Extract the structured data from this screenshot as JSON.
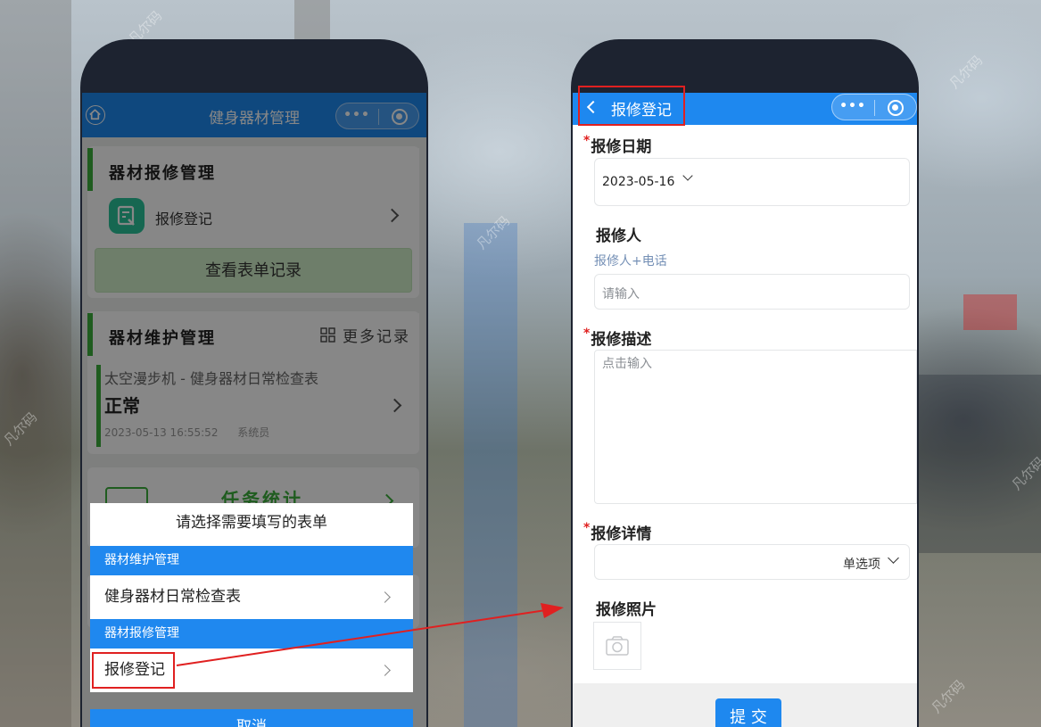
{
  "left": {
    "nav_title": "健身器材管理",
    "capsule_more": "•••",
    "repair_section_title": "器材报修管理",
    "repair_item_label": "报修登记",
    "view_records_label": "查看表单记录",
    "maint_section_title": "器材维护管理",
    "more_records_label": "更多记录",
    "record": {
      "title": "太空漫步机 - 健身器材日常检查表",
      "status": "正常",
      "time": "2023-05-13 16:55:52",
      "user": "系统员"
    },
    "task_stats_label": "任务统计",
    "sheet": {
      "title": "请选择需要填写的表单",
      "groups": [
        {
          "name": "器材维护管理",
          "items": [
            "健身器材日常检查表"
          ]
        },
        {
          "name": "器材报修管理",
          "items": [
            "报修登记"
          ]
        }
      ],
      "cancel_label": "取消"
    }
  },
  "right": {
    "nav_title": "报修登记",
    "capsule_more": "•••",
    "fields": {
      "date": {
        "label": "报修日期",
        "required": true,
        "value": "2023-05-16"
      },
      "reporter": {
        "label": "报修人",
        "hint": "报修人+电话",
        "placeholder": "请输入"
      },
      "description": {
        "label": "报修描述",
        "required": true,
        "placeholder": "点击输入"
      },
      "detail": {
        "label": "报修详情",
        "required": true,
        "value": "单选项"
      },
      "photo": {
        "label": "报修照片"
      }
    },
    "submit_label": "提 交"
  },
  "watermark": "凡尔码",
  "colors": {
    "nav_blue": "#1e88ef",
    "accent_green": "#3cae3c",
    "highlight_red": "#e02020",
    "required_red": "#e0201f"
  },
  "icons": [
    "home-icon",
    "more-icon",
    "target-icon",
    "clipboard-app-icon",
    "chevron-right-icon",
    "grid-icon",
    "back-icon",
    "chevron-down-icon",
    "camera-icon"
  ]
}
